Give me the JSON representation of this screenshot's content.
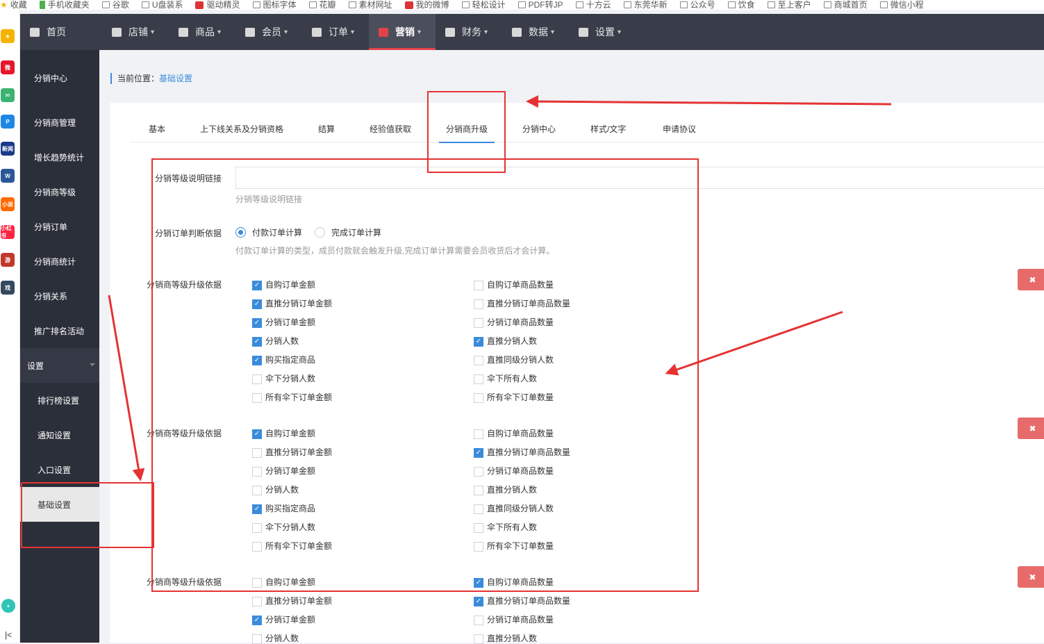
{
  "bookmarks": [
    {
      "label": "收藏",
      "icon": "star-icon"
    },
    {
      "label": "手机收藏夹",
      "icon": "phone-icon"
    },
    {
      "label": "谷歌",
      "icon": "folder-icon"
    },
    {
      "label": "U盘装系",
      "icon": "folder-icon"
    },
    {
      "label": "驱动精灵",
      "icon": "driver-icon"
    },
    {
      "label": "图标字体",
      "icon": "folder-icon"
    },
    {
      "label": "花瓣",
      "icon": "folder-icon"
    },
    {
      "label": "素材网址",
      "icon": "folder-icon"
    },
    {
      "label": "我的微博",
      "icon": "weibo-icon"
    },
    {
      "label": "轻松设计",
      "icon": "folder-icon"
    },
    {
      "label": "PDF转JP",
      "icon": "folder-icon"
    },
    {
      "label": "十方云",
      "icon": "folder-icon"
    },
    {
      "label": "东莞华新",
      "icon": "page-icon"
    },
    {
      "label": "公众号",
      "icon": "page-icon"
    },
    {
      "label": "饮食",
      "icon": "folder-icon"
    },
    {
      "label": "至上客户",
      "icon": "folder-icon"
    },
    {
      "label": "商城首页",
      "icon": "page-icon"
    },
    {
      "label": "微信小程",
      "icon": "folder-icon"
    }
  ],
  "browser_sidebar": [
    {
      "name": "favorites-icon",
      "text": "★",
      "color": "#f5b301"
    },
    {
      "name": "weibo-icon",
      "text": "微",
      "color": "#e6162d"
    },
    {
      "name": "mail-icon",
      "text": "✉",
      "color": "#3cb371"
    },
    {
      "name": "pinduoduo-icon",
      "text": "P",
      "color": "#1e88e5"
    },
    {
      "name": "news-icon",
      "text": "新闻",
      "color": "#1a3a8a"
    },
    {
      "name": "word-icon",
      "text": "W",
      "color": "#2b579a"
    },
    {
      "name": "novel-icon",
      "text": "小说",
      "color": "#ff6a00"
    },
    {
      "name": "xiaohongshu-icon",
      "text": "小红书",
      "color": "#ff2442"
    },
    {
      "name": "game-icon",
      "text": "游",
      "color": "#c0392b"
    },
    {
      "name": "game2-icon",
      "text": "戏",
      "color": "#34495e"
    }
  ],
  "topnav": [
    {
      "label": "首页",
      "icon": "home-icon",
      "caret": ""
    },
    {
      "label": "店铺",
      "icon": "store-icon",
      "caret": "▾"
    },
    {
      "label": "商品",
      "icon": "goods-icon",
      "caret": "▾"
    },
    {
      "label": "会员",
      "icon": "user-icon",
      "caret": "▾"
    },
    {
      "label": "订单",
      "icon": "order-icon",
      "caret": "▾"
    },
    {
      "label": "营销",
      "icon": "gift-icon",
      "caret": "▾"
    },
    {
      "label": "财务",
      "icon": "finance-icon",
      "caret": "▾"
    },
    {
      "label": "数据",
      "icon": "chart-icon",
      "caret": "▾"
    },
    {
      "label": "设置",
      "icon": "gear-icon",
      "caret": "▾"
    }
  ],
  "sidebar": {
    "items": [
      "分销中心",
      "分销商管理",
      "增长趋势统计",
      "分销商等级",
      "分销订单",
      "分销商统计",
      "分销关系",
      "推广排名活动"
    ],
    "group": "设置",
    "sub_items": [
      "排行榜设置",
      "通知设置",
      "入口设置",
      "基础设置"
    ]
  },
  "breadcrumb": {
    "prefix": "当前位置：",
    "current": "基础设置"
  },
  "tabs": [
    "基本",
    "上下线关系及分销资格",
    "结算",
    "经验值获取",
    "分销商升级",
    "分销中心",
    "样式/文字",
    "申请协议"
  ],
  "form": {
    "link_label": "分销等级说明链接",
    "link_value": "",
    "link_help": "分销等级说明链接",
    "order_label": "分销订单判断依据",
    "order_options": [
      "付款订单计算",
      "完成订单计算"
    ],
    "order_help": "付款订单计算的类型，成员付款就会触发升级,完成订单计算需要会员收货后才会计算。",
    "basis_label": "分销商等级升级依据",
    "left_options": [
      "自购订单金额",
      "直推分销订单金额",
      "分销订单金额",
      "分销人数",
      "购买指定商品",
      "伞下分销人数",
      "所有伞下订单金额"
    ],
    "right_options": [
      "自购订单商品数量",
      "直推分销订单商品数量",
      "分销订单商品数量",
      "直推分销人数",
      "直推同级分销人数",
      "伞下所有人数",
      "所有伞下订单数量"
    ],
    "delete_label": "✖",
    "groups": [
      {
        "left": [
          true,
          true,
          true,
          true,
          true,
          false,
          false
        ],
        "right": [
          false,
          false,
          false,
          true,
          false,
          false,
          false
        ]
      },
      {
        "left": [
          true,
          false,
          false,
          false,
          true,
          false,
          false
        ],
        "right": [
          false,
          true,
          false,
          false,
          false,
          false,
          false
        ]
      },
      {
        "left": [
          false,
          false,
          true,
          false
        ],
        "right": [
          true,
          true,
          false,
          false
        ]
      }
    ]
  },
  "annotation_color": "#e53333",
  "accent_color": "#3b8bdb"
}
